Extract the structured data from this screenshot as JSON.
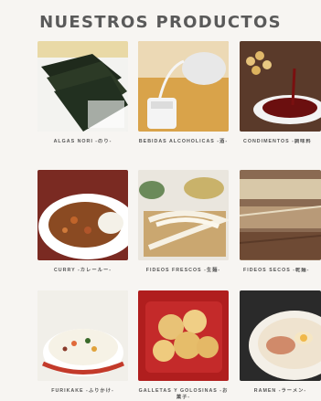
{
  "header": {
    "title": "NUESTROS PRODUCTOS"
  },
  "products": [
    {
      "label": "ALGAS NORI -のり-"
    },
    {
      "label": "BEBIDAS ALCOHOLICAS -酒-"
    },
    {
      "label": "CONDIMENTOS -調味料"
    },
    {
      "label": "CURRY -カレールー-"
    },
    {
      "label": "FIDEOS FRESCOS -生麺-"
    },
    {
      "label": "FIDEOS SECOS -乾麺-"
    },
    {
      "label": "FURIKAKE -ふりかけ-"
    },
    {
      "label": "GALLETAS Y GOLOSINAS -お菓子-"
    },
    {
      "label": "RAMEN -ラーメン-"
    }
  ]
}
